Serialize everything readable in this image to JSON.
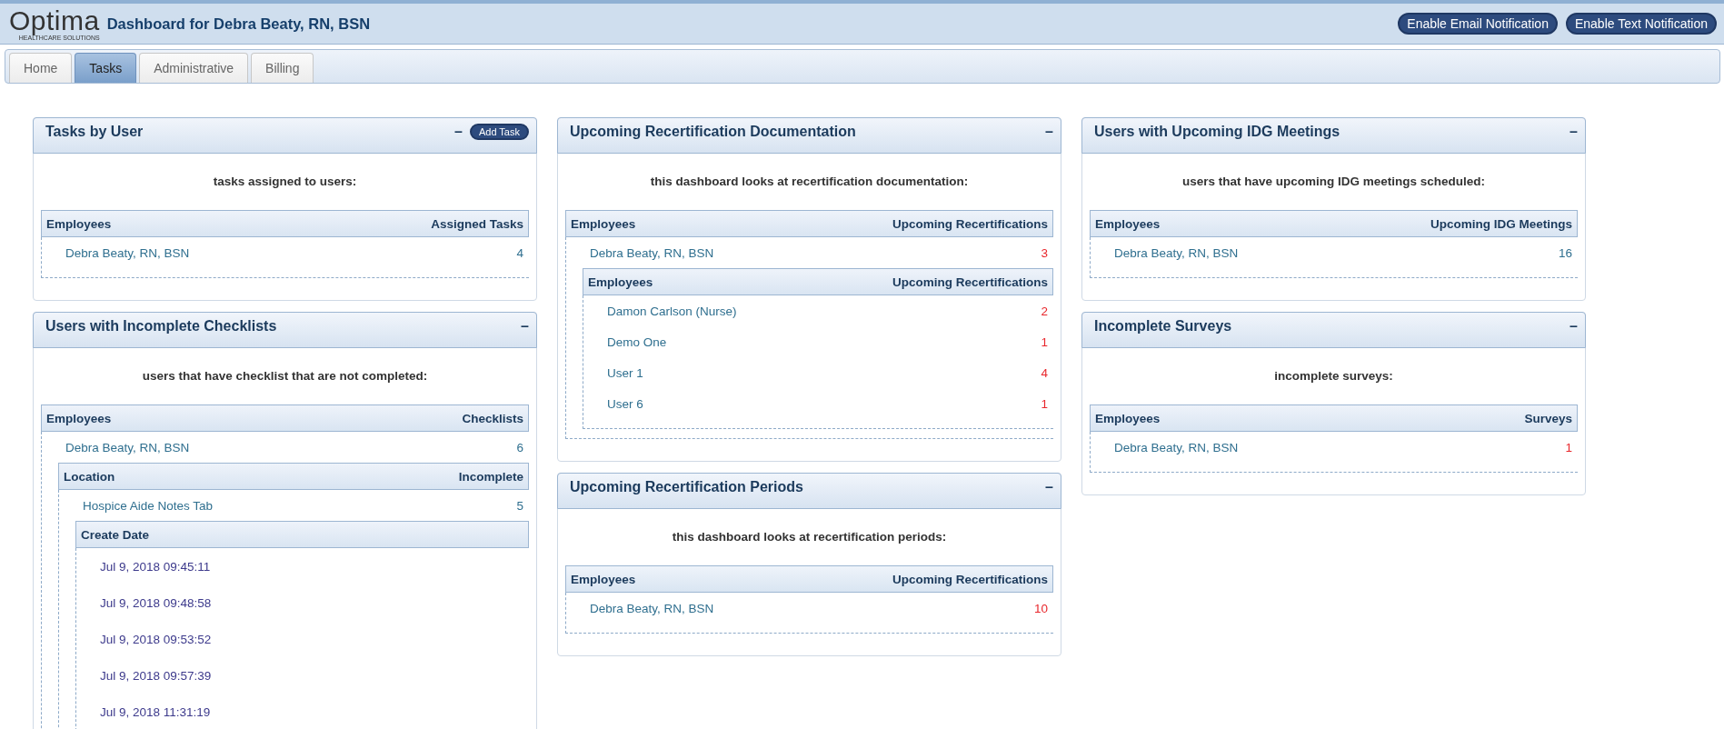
{
  "header": {
    "logo": "Optima",
    "logo_tagline": "HEALTHCARE SOLUTIONS",
    "title": "Dashboard for Debra Beaty, RN, BSN",
    "buttons": [
      "Enable Email Notification",
      "Enable Text Notification"
    ]
  },
  "tabs": [
    {
      "label": "Home",
      "selected": false
    },
    {
      "label": "Tasks",
      "selected": true
    },
    {
      "label": "Administrative",
      "selected": false
    },
    {
      "label": "Billing",
      "selected": false
    }
  ],
  "columns": [
    {
      "panels": [
        {
          "title": "Tasks by User",
          "collapse": "–",
          "action": "Add Task",
          "description": "tasks assigned to users:",
          "table": {
            "columns": [
              "Employees",
              "Assigned Tasks"
            ],
            "rows": [
              {
                "cells": [
                  "Debra Beaty, RN, BSN",
                  "4"
                ],
                "overdue": false
              }
            ]
          }
        },
        {
          "title": "Users with Incomplete Checklists",
          "collapse": "–",
          "description": "users that have checklist that are not completed:",
          "table": {
            "columns": [
              "Employees",
              "Checklists"
            ],
            "rows": [
              {
                "cells": [
                  "Debra Beaty, RN, BSN",
                  "6"
                ],
                "overdue": false,
                "children": {
                  "columns": [
                    "Location",
                    "Incomplete"
                  ],
                  "rows": [
                    {
                      "cells": [
                        "Hospice Aide Notes Tab",
                        "5"
                      ],
                      "overdue": false,
                      "children": {
                        "columns": [
                          "Create Date"
                        ],
                        "rows": [
                          {
                            "cells": [
                              "Jul 9, 2018 09:45:11"
                            ]
                          },
                          {
                            "cells": [
                              "Jul 9, 2018 09:48:58"
                            ]
                          },
                          {
                            "cells": [
                              "Jul 9, 2018 09:53:52"
                            ]
                          },
                          {
                            "cells": [
                              "Jul 9, 2018 09:57:39"
                            ]
                          },
                          {
                            "cells": [
                              "Jul 9, 2018 11:31:19"
                            ]
                          }
                        ]
                      }
                    }
                  ]
                }
              }
            ]
          }
        }
      ]
    },
    {
      "panels": [
        {
          "title": "Upcoming Recertification Documentation",
          "collapse": "–",
          "description": "this dashboard looks at recertification documentation:",
          "table": {
            "columns": [
              "Employees",
              "Upcoming Recertifications"
            ],
            "rows": [
              {
                "cells": [
                  "Debra Beaty, RN, BSN",
                  "3"
                ],
                "overdue": true,
                "children": {
                  "columns": [
                    "Employees",
                    "Upcoming Recertifications"
                  ],
                  "rows": [
                    {
                      "cells": [
                        "Damon Carlson (Nurse)",
                        "2"
                      ],
                      "overdue": true
                    },
                    {
                      "cells": [
                        "Demo One",
                        "1"
                      ],
                      "overdue": true
                    },
                    {
                      "cells": [
                        "User 1",
                        "4"
                      ],
                      "overdue": true
                    },
                    {
                      "cells": [
                        "User 6",
                        "1"
                      ],
                      "overdue": true
                    }
                  ]
                }
              }
            ]
          }
        },
        {
          "title": "Upcoming Recertification Periods",
          "collapse": "–",
          "description": "this dashboard looks at recertification periods:",
          "table": {
            "columns": [
              "Employees",
              "Upcoming Recertifications"
            ],
            "rows": [
              {
                "cells": [
                  "Debra Beaty, RN, BSN",
                  "10"
                ],
                "overdue": true
              }
            ]
          }
        }
      ]
    },
    {
      "panels": [
        {
          "title": "Users with Upcoming IDG Meetings",
          "collapse": "–",
          "description": "users that have upcoming IDG meetings scheduled:",
          "table": {
            "columns": [
              "Employees",
              "Upcoming IDG Meetings"
            ],
            "rows": [
              {
                "cells": [
                  "Debra Beaty, RN, BSN",
                  "16"
                ],
                "overdue": false
              }
            ]
          }
        },
        {
          "title": "Incomplete Surveys",
          "collapse": "–",
          "description": "incomplete surveys:",
          "table": {
            "columns": [
              "Employees",
              "Surveys"
            ],
            "rows": [
              {
                "cells": [
                  "Debra Beaty, RN, BSN",
                  "1"
                ],
                "overdue": true
              }
            ]
          }
        }
      ]
    }
  ]
}
